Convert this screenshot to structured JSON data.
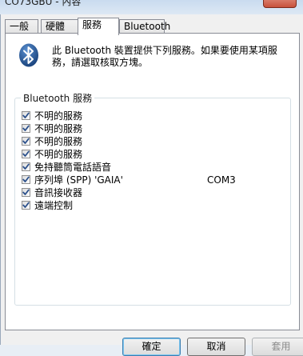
{
  "window": {
    "title": "CO73GBU - 內容"
  },
  "tabs": [
    {
      "label": "一般",
      "active": false
    },
    {
      "label": "硬體",
      "active": false
    },
    {
      "label": "服務",
      "active": true
    },
    {
      "label": "Bluetooth",
      "active": false
    }
  ],
  "panel": {
    "icon": "bluetooth-icon",
    "description": "此 Bluetooth 裝置提供下列服務。如果要使用某項服務，請選取核取方塊。",
    "group_title": "Bluetooth 服務",
    "services": [
      {
        "name": "不明的服務",
        "port": "",
        "checked": true
      },
      {
        "name": "不明的服務",
        "port": "",
        "checked": true
      },
      {
        "name": "不明的服務",
        "port": "",
        "checked": true
      },
      {
        "name": "不明的服務",
        "port": "",
        "checked": true
      },
      {
        "name": "免持聽筒電話語音",
        "port": "",
        "checked": true
      },
      {
        "name": "序列埠 (SPP) 'GAIA'",
        "port": "COM3",
        "checked": true
      },
      {
        "name": "音訊接收器",
        "port": "",
        "checked": true
      },
      {
        "name": "遠端控制",
        "port": "",
        "checked": true
      }
    ]
  },
  "buttons": {
    "ok": "確定",
    "cancel": "取消",
    "apply": "套用"
  },
  "colors": {
    "bluetooth_icon": "#1d5a9e",
    "checkmark": "#2a4f8a"
  }
}
